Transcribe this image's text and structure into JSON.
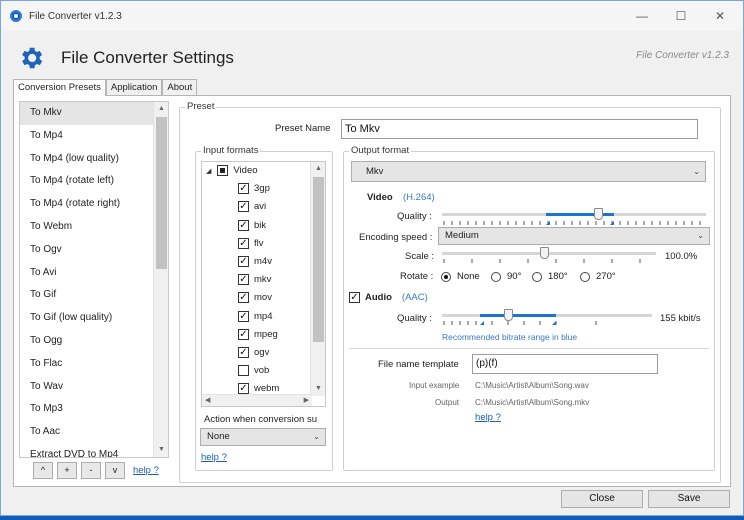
{
  "window": {
    "title": "File Converter v1.2.3",
    "controls": [
      "—",
      "☐",
      "✕"
    ]
  },
  "header": {
    "title": "File Converter Settings",
    "version": "File Converter v1.2.3"
  },
  "tabs": [
    {
      "label": "Conversion Presets",
      "active": true
    },
    {
      "label": "Application",
      "active": false
    },
    {
      "label": "About",
      "active": false
    }
  ],
  "presets": {
    "items": [
      "To Mkv",
      "To Mp4",
      "To Mp4 (low quality)",
      "To Mp4 (rotate left)",
      "To Mp4 (rotate right)",
      "To Webm",
      "To Ogv",
      "To Avi",
      "To Gif",
      "To Gif (low quality)",
      "To Ogg",
      "To Flac",
      "To Wav",
      "To Mp3",
      "To Aac",
      "Extract DVD to Mp4"
    ],
    "selected_index": 0,
    "buttons": [
      "^",
      "+",
      "-",
      "v"
    ],
    "help": "help ?"
  },
  "preset": {
    "group_label": "Preset",
    "name_label": "Preset Name",
    "name_value": "To Mkv"
  },
  "input_formats": {
    "group_label": "Input formats",
    "root": "Video",
    "formats": [
      {
        "name": "3gp",
        "checked": true
      },
      {
        "name": "avi",
        "checked": true
      },
      {
        "name": "bik",
        "checked": true
      },
      {
        "name": "flv",
        "checked": true
      },
      {
        "name": "m4v",
        "checked": true
      },
      {
        "name": "mkv",
        "checked": true
      },
      {
        "name": "mov",
        "checked": true
      },
      {
        "name": "mp4",
        "checked": true
      },
      {
        "name": "mpeg",
        "checked": true
      },
      {
        "name": "ogv",
        "checked": true
      },
      {
        "name": "vob",
        "checked": false
      },
      {
        "name": "webm",
        "checked": true
      }
    ],
    "action_label": "Action when conversion su",
    "action_value": "None",
    "help": "help ?"
  },
  "output": {
    "group_label": "Output format",
    "format_value": "Mkv",
    "video": {
      "label": "Video",
      "codec": "(H.264)",
      "quality_label": "Quality :",
      "quality_level": 0.6,
      "encoding_label": "Encoding speed :",
      "encoding_value": "Medium",
      "scale_label": "Scale :",
      "scale_value": "100.0%",
      "rotate_label": "Rotate :",
      "rotate_options": [
        "None",
        "90°",
        "180°",
        "270°"
      ],
      "rotate_selected": 0
    },
    "audio": {
      "enabled": true,
      "label": "Audio",
      "codec": "(AAC)",
      "quality_label": "Quality :",
      "quality_value": "155 kbit/s",
      "recommended_note": "Recommended bitrate range in blue"
    },
    "file_name": {
      "label": "File name template",
      "value": "(p)(f)",
      "input_example_label": "Input example",
      "input_example": "C:\\Music\\Artist\\Album\\Song.wav",
      "output_label": "Output",
      "output_example": "C:\\Music\\Artist\\Album\\Song.mkv",
      "help": "help ?"
    }
  },
  "footer": {
    "close": "Close",
    "save": "Save"
  },
  "colors": {
    "accent": "#1b74d0",
    "gear": "#1e63b4",
    "link": "#1a5fb4"
  }
}
